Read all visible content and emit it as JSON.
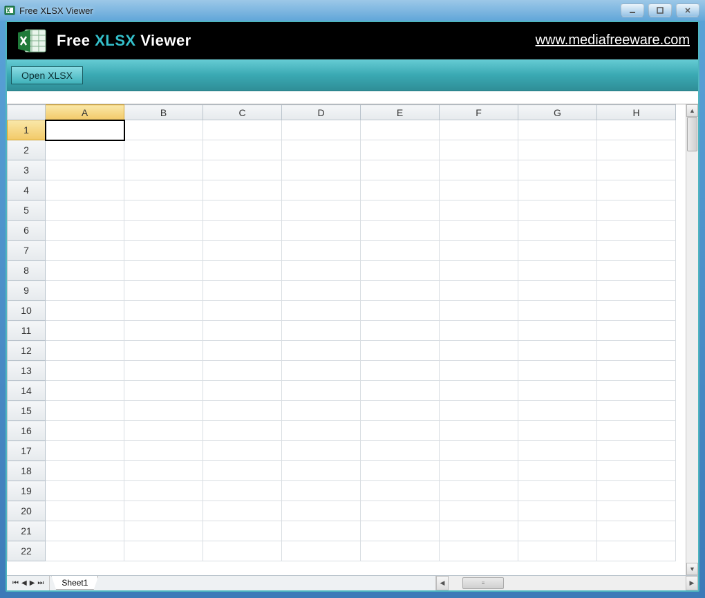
{
  "window": {
    "title": "Free XLSX Viewer"
  },
  "banner": {
    "free": "Free",
    "xlsx": "XLSX",
    "viewer": "Viewer",
    "url": "www.mediafreeware.com"
  },
  "toolbar": {
    "open_label": "Open XLSX"
  },
  "sheet": {
    "columns": [
      "A",
      "B",
      "C",
      "D",
      "E",
      "F",
      "G",
      "H"
    ],
    "rows": [
      "1",
      "2",
      "3",
      "4",
      "5",
      "6",
      "7",
      "8",
      "9",
      "10",
      "11",
      "12",
      "13",
      "14",
      "15",
      "16",
      "17",
      "18",
      "19",
      "20",
      "21",
      "22"
    ],
    "selected_col": "A",
    "selected_row": "1",
    "tab_name": "Sheet1"
  }
}
